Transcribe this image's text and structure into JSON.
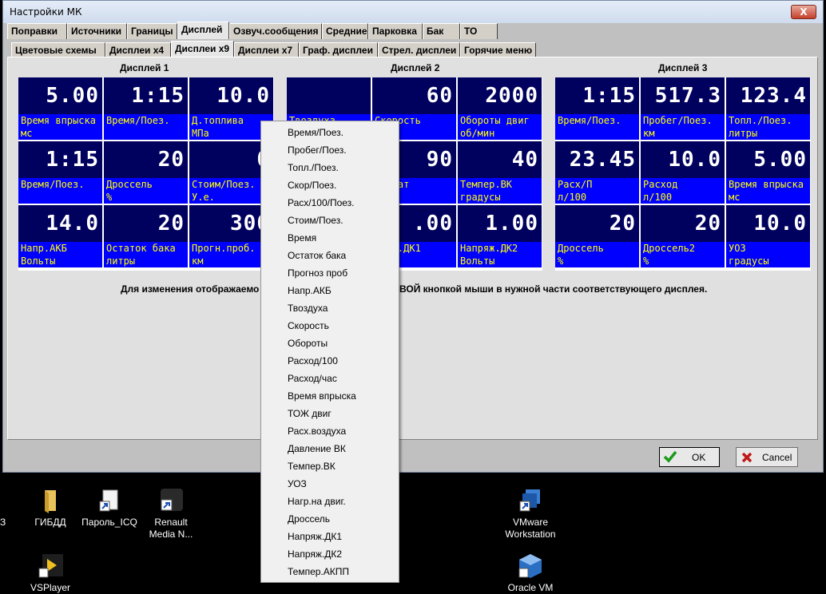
{
  "window": {
    "title": "Настройки МК",
    "close_symbol": "X"
  },
  "tabs_row1": [
    "Поправки",
    "Источники",
    "Границы",
    "Дисплей",
    "Озвуч.сообщения",
    "Средние",
    "Парковка",
    "Бак",
    "ТО"
  ],
  "tabs_row2": [
    "Цветовые схемы",
    "Дисплеи х4",
    "Дисплеи х9",
    "Дисплеи х7",
    "Граф. дисплеи",
    "Стрел. дисплеи",
    "Горячие меню"
  ],
  "groups": [
    {
      "label": "Дисплей 1",
      "cells": [
        {
          "value": "5.00",
          "label": "Время впрыска\nмс"
        },
        {
          "value": "1:15",
          "label": "Время/Поез."
        },
        {
          "value": "10.0",
          "label": "Д.топлива\nМПа"
        },
        {
          "value": "1:15",
          "label": "Время/Поез."
        },
        {
          "value": "20",
          "label": "Дроссель\n%"
        },
        {
          "value": "0",
          "label": "Стоим/Поез.\nУ.е."
        },
        {
          "value": "14.0",
          "label": "Напр.АКБ\nВольты"
        },
        {
          "value": "20",
          "label": "Остаток бака\nлитры"
        },
        {
          "value": "300",
          "label": "Прогн.проб.\nкм"
        }
      ]
    },
    {
      "label": "Дисплей 2",
      "cells": [
        {
          "value": "",
          "label": "Твоздуха"
        },
        {
          "value": "60",
          "label": "Скорость\nчас"
        },
        {
          "value": "2000",
          "label": "Обороты двиг\nоб/мин"
        },
        {
          "value": "",
          "label": ""
        },
        {
          "value": "90",
          "label": "двигат\nусы"
        },
        {
          "value": "40",
          "label": "Темпер.ВК\nградусы"
        },
        {
          "value": "",
          "label": ""
        },
        {
          "value": ".00",
          "label": "пряж.ДК1\nьты"
        },
        {
          "value": "1.00",
          "label": "Напряж.ДК2\nВольты"
        }
      ]
    },
    {
      "label": "Дисплей 3",
      "cells": [
        {
          "value": "1:15",
          "label": "Время/Поез."
        },
        {
          "value": "517.3",
          "label": "Пробег/Поез.\nкм"
        },
        {
          "value": "123.4",
          "label": "Топл./Поез.\nлитры"
        },
        {
          "value": "23.45",
          "label": "Расх/П\nл/100"
        },
        {
          "value": "10.0",
          "label": "Расход\nл/100"
        },
        {
          "value": "5.00",
          "label": "Время впрыска\nмс"
        },
        {
          "value": "20",
          "label": "Дроссель\n%"
        },
        {
          "value": "20",
          "label": "Дроссель2\n%"
        },
        {
          "value": "10.0",
          "label": "УОЗ\nградусы"
        }
      ]
    }
  ],
  "hint_left": "Для изменения отображаемо",
  "hint_right": "ВОЙ кнопкой мыши в нужной части соответствующего дисплея.",
  "buttons": {
    "ok": "OK",
    "cancel": "Cancel"
  },
  "context_menu": [
    "Время/Поез.",
    "Пробег/Поез.",
    "Топл./Поез.",
    "Скор/Поез.",
    "Расх/100/Поез.",
    "Стоим/Поез.",
    "Время",
    "Остаток бака",
    "Прогноз проб",
    "Напр.АКБ",
    "Твоздуха",
    "Скорость",
    "Обороты",
    "Расход/100",
    "Расход/час",
    "Время впрыска",
    "ТОЖ двиг",
    "Расх.воздуха",
    "Давление ВК",
    "Темпер.ВК",
    "УОЗ",
    "Нагр.на двиг.",
    "Дроссель",
    "Напряж.ДК1",
    "Напряж.ДК2",
    "Темпер.АКПП"
  ],
  "desktop": {
    "left_edge_text": "З",
    "icons": [
      {
        "label": "ГИБДД",
        "icon": "folder-icon"
      },
      {
        "label": "Пароль_ICQ",
        "icon": "document-shortcut-icon"
      },
      {
        "label": "Renault\nMedia N...",
        "icon": "app-shortcut-icon"
      },
      {
        "label": "VMware\nWorkstation",
        "icon": "vmware-icon"
      },
      {
        "label": "VSPlayer",
        "icon": "vsplayer-icon"
      },
      {
        "label": "Oracle VM",
        "icon": "virtualbox-icon"
      }
    ]
  }
}
